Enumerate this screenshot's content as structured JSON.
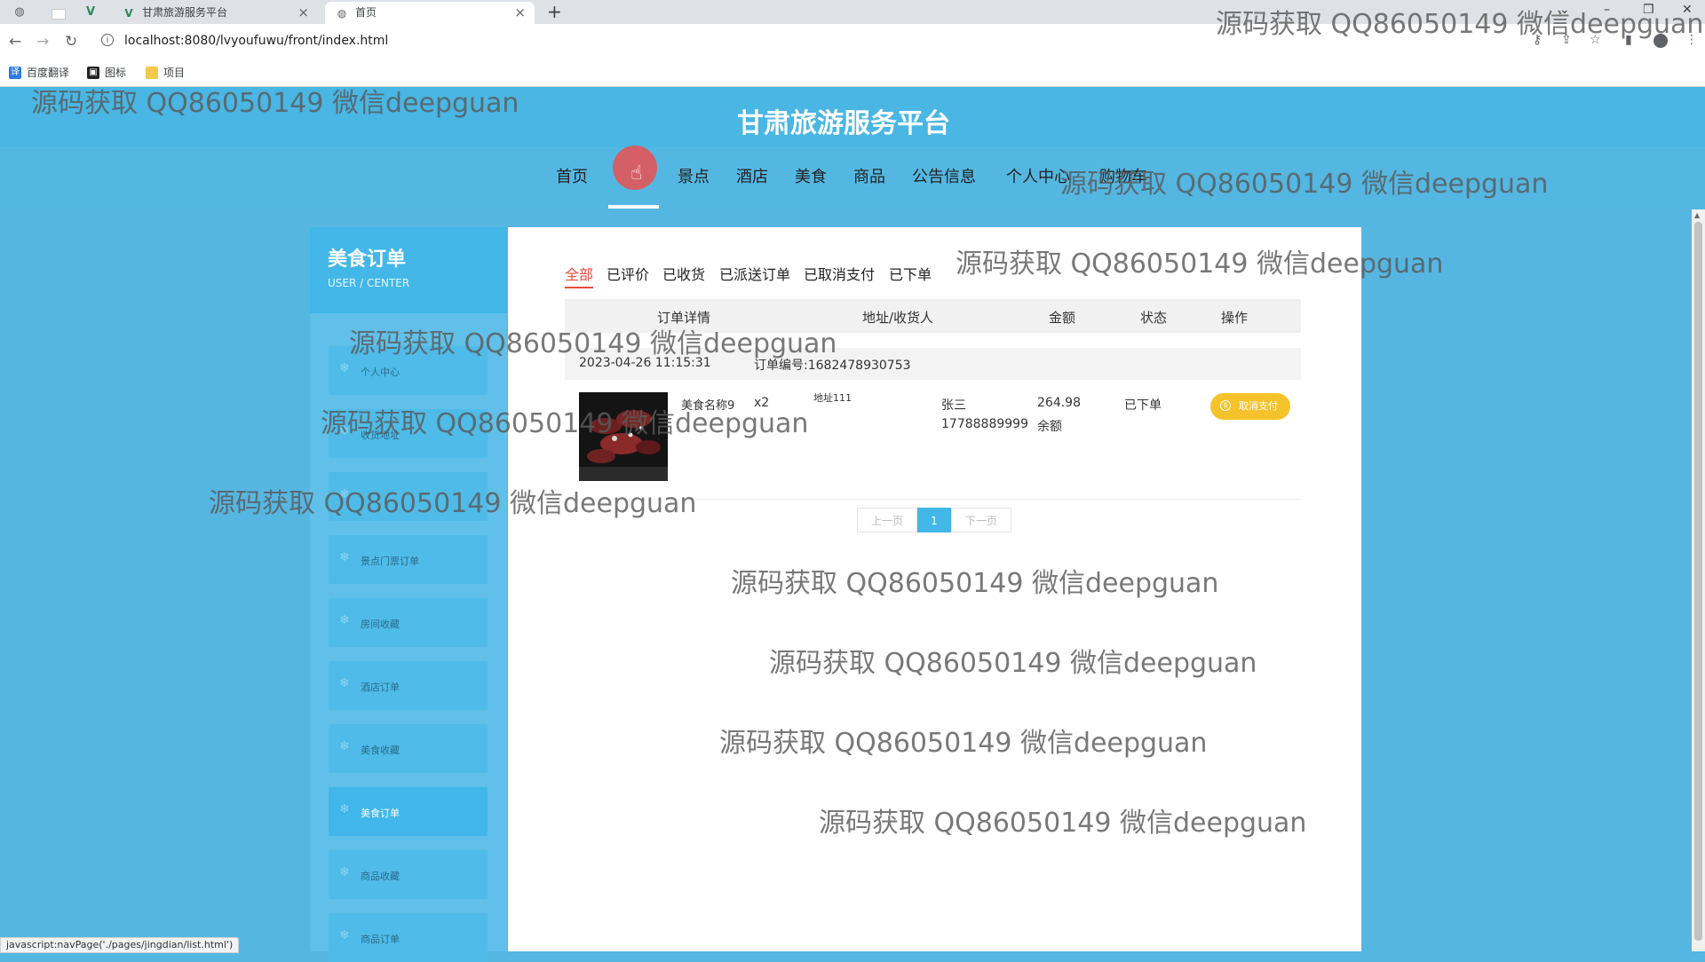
{
  "browser": {
    "tabs": [
      {
        "title": ""
      },
      {
        "title": "甘肃旅游服务平台"
      },
      {
        "title": "首页"
      }
    ],
    "new_tab": "+",
    "url": "localhost:8080/lvyoufuwu/front/index.html",
    "bookmarks": [
      "百度翻译",
      "图标",
      "项目"
    ],
    "status_url": "javascript:navPage('./pages/jingdian/list.html')"
  },
  "site": {
    "title": "甘肃旅游服务平台",
    "nav": [
      "首页",
      "",
      "景点",
      "酒店",
      "美食",
      "商品",
      "公告信息",
      "个人中心",
      "购物车"
    ]
  },
  "sidebar": {
    "title": "美食订单",
    "subtitle": "USER / CENTER",
    "items": [
      {
        "label": "个人中心",
        "icon": "snowflake-icon"
      },
      {
        "label": "收货地址",
        "icon": "snowflake-icon"
      },
      {
        "label": "",
        "icon": "snowflake-icon"
      },
      {
        "label": "景点门票订单",
        "icon": "snowflake-icon"
      },
      {
        "label": "房间收藏",
        "icon": "snowflake-icon"
      },
      {
        "label": "酒店订单",
        "icon": "snowflake-icon"
      },
      {
        "label": "美食收藏",
        "icon": "snowflake-icon"
      },
      {
        "label": "美食订单",
        "icon": "snowflake-icon"
      },
      {
        "label": "商品收藏",
        "icon": "snowflake-icon"
      },
      {
        "label": "商品订单",
        "icon": "snowflake-icon"
      }
    ]
  },
  "filters": [
    "全部",
    "已评价",
    "已收货",
    "已派送订单",
    "已取消支付",
    "已下单"
  ],
  "table": {
    "headers": [
      "订单详情",
      "地址/收货人",
      "金额",
      "状态",
      "操作"
    ]
  },
  "order": {
    "time": "2023-04-26 11:15:31",
    "number": "订单编号:1682478930753",
    "food_name": "美食名称9",
    "qty": "x2",
    "address": "地址111",
    "receiver": "张三",
    "phone": "17788889999",
    "amount": "264.98",
    "pay": "余额",
    "status": "已下单",
    "action": "取消支付"
  },
  "pager": {
    "prev": "上一页",
    "current": "1",
    "next": "下一页"
  },
  "watermark": "源码获取 QQ86050149 微信deepguan",
  "colors": {
    "header": "#49b6e4",
    "accent": "#42b7e8",
    "active_filter": "#e74c3c",
    "cancel_button": "#f6c22c"
  }
}
